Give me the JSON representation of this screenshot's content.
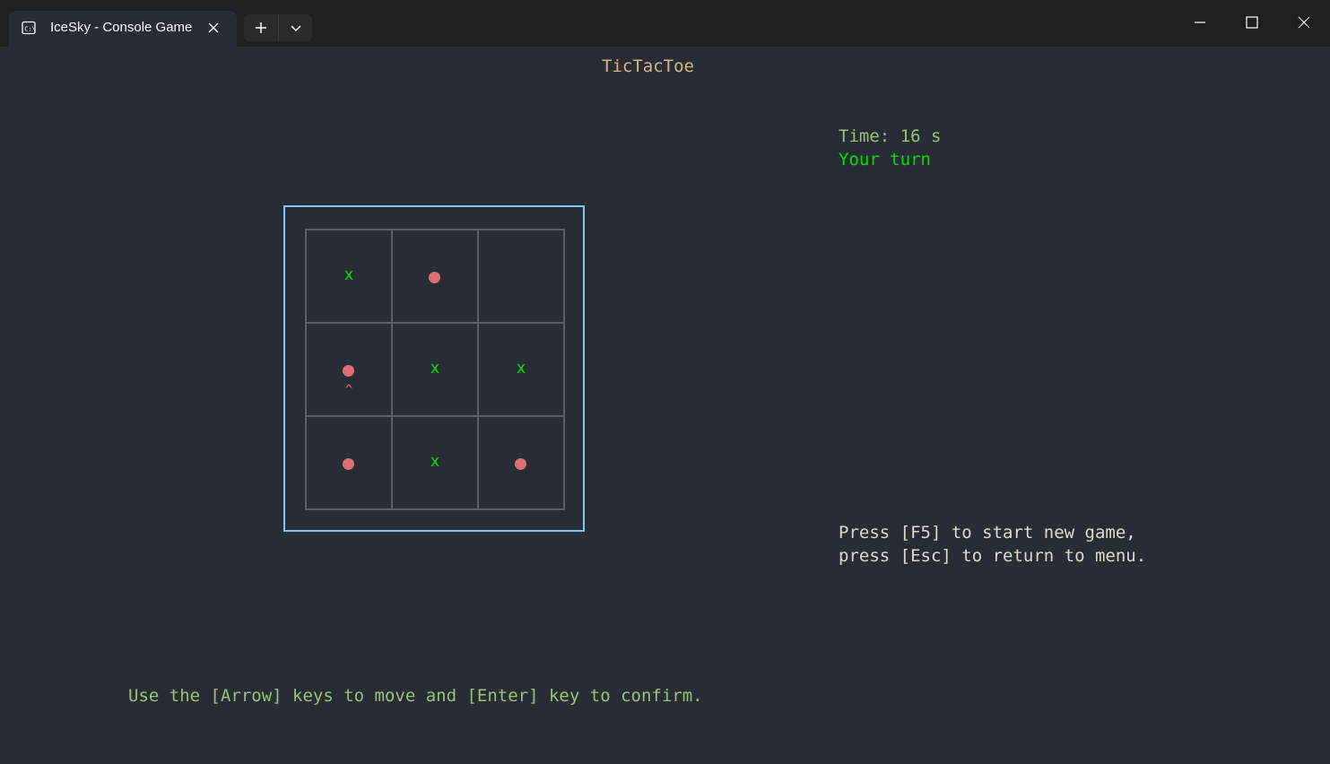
{
  "window": {
    "tab_title": "IceSky - Console Game",
    "icon": "console-icon"
  },
  "game": {
    "title": "TicTacToe",
    "time": "Time: 16 s",
    "status": "Your turn",
    "help_line_1": "Press [F5] to start new game,",
    "help_line_2": "press [Esc] to return to menu.",
    "hint": "Use the [Arrow] keys to move and [Enter] key to confirm.",
    "x_symbol": "x",
    "cursor_symbol": "^",
    "board": [
      [
        "x",
        "o",
        ""
      ],
      [
        "o",
        "x",
        "x"
      ],
      [
        "o",
        "x",
        "o"
      ]
    ],
    "cursor": {
      "row": 1,
      "col": 0
    }
  },
  "colors": {
    "background": "#282c34",
    "player_x": "#00e000",
    "player_o": "#e06c75",
    "board_frame": "#7ec8ff",
    "grid": "#5a5f6e"
  }
}
